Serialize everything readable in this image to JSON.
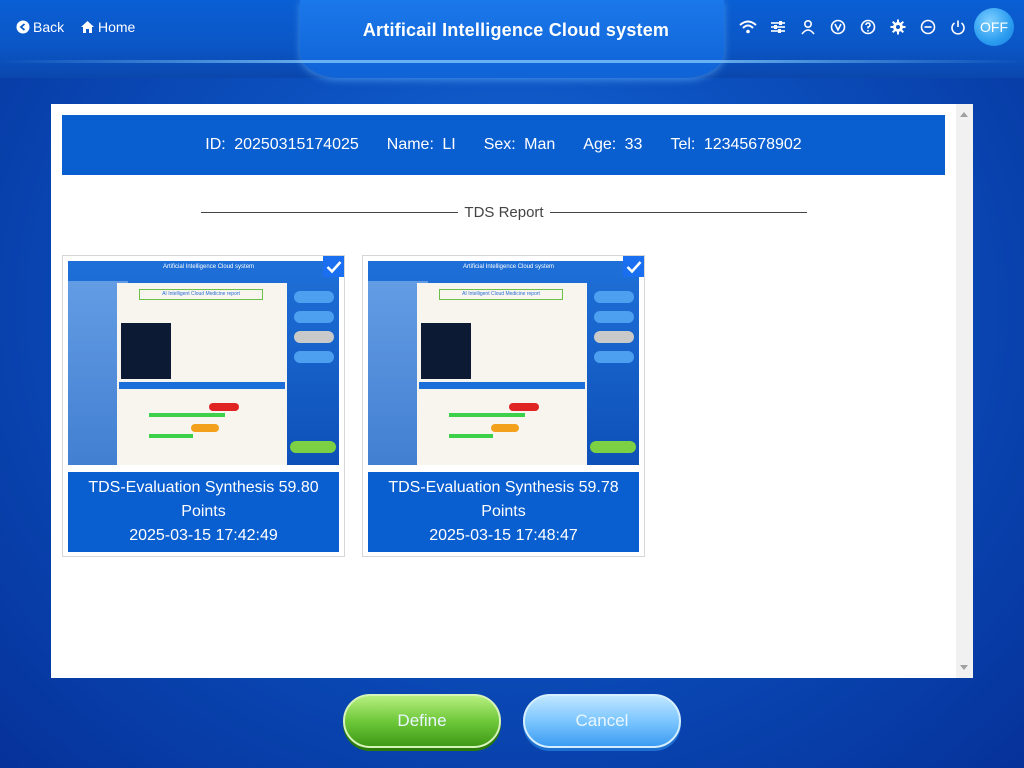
{
  "header": {
    "back_label": "Back",
    "home_label": "Home",
    "title": "Artificail Intelligence Cloud system",
    "off_label": "OFF"
  },
  "patient": {
    "id_label": "ID:",
    "id_value": "20250315174025",
    "name_label": "Name:",
    "name_value": "LI",
    "sex_label": "Sex:",
    "sex_value": "Man",
    "age_label": "Age:",
    "age_value": "33",
    "tel_label": "Tel:",
    "tel_value": "12345678902"
  },
  "section": {
    "title": "TDS Report"
  },
  "reports": [
    {
      "line1": "TDS-Evaluation Synthesis 59.80",
      "line2": "Points",
      "timestamp": "2025-03-15 17:42:49",
      "selected": true
    },
    {
      "line1": "TDS-Evaluation Synthesis 59.78",
      "line2": "Points",
      "timestamp": "2025-03-15 17:48:47",
      "selected": true
    }
  ],
  "thumbnail": {
    "title": "Artificial Intelligence Cloud system",
    "banner": "AI Intelligent Cloud Medicine report"
  },
  "actions": {
    "define_label": "Define",
    "cancel_label": "Cancel"
  },
  "colors": {
    "info_bar": "#0a5fd0",
    "define_green": "#6fc83a",
    "cancel_blue": "#7cc6ff",
    "check_blue": "#1a6ff0"
  },
  "icons": [
    "wifi-icon",
    "sliders-icon",
    "user-icon",
    "v-circle-icon",
    "help-icon",
    "gear-icon",
    "minus-circle-icon",
    "power-icon"
  ]
}
